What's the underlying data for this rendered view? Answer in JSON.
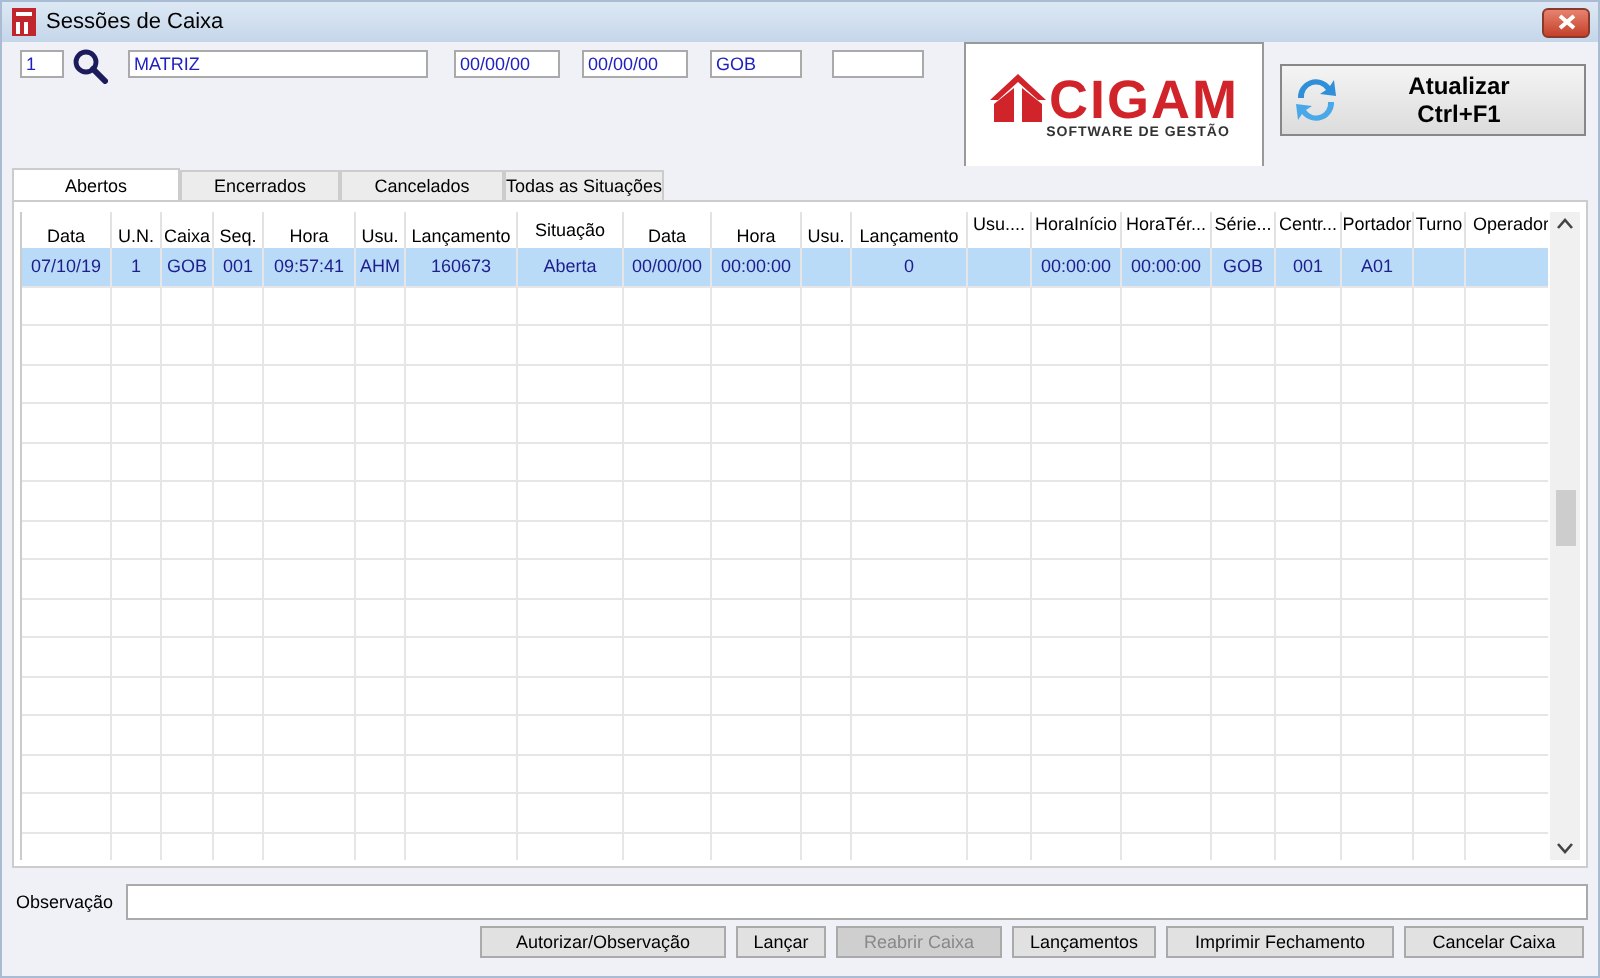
{
  "window": {
    "title": "Sessões de Caixa"
  },
  "filters": [
    {
      "kind": "short",
      "value": "1"
    },
    {
      "kind": "search"
    },
    {
      "kind": "wide",
      "value": "MATRIZ"
    },
    {
      "kind": "date",
      "value": "00/00/00"
    },
    {
      "kind": "date",
      "value": "00/00/00"
    },
    {
      "kind": "code",
      "value": "GOB"
    },
    {
      "kind": "code"
    }
  ],
  "logo": {
    "name": "CIGAM",
    "tagline": "SOFTWARE DE GESTÃO"
  },
  "refresh_button": {
    "label": "Atualizar",
    "shortcut": "Ctrl+F1"
  },
  "tabs": [
    {
      "label": "Abertos",
      "selected": true
    },
    {
      "label": "Encerrados",
      "selected": false
    },
    {
      "label": "Cancelados",
      "selected": false
    },
    {
      "label": "Todas as Situações",
      "selected": false
    }
  ],
  "table": {
    "columns": [
      "Data",
      "U.N.",
      "Caixa",
      "Seq.",
      "Hora",
      "Usu.",
      "Lançamento",
      "Situação",
      "Data",
      "Hora",
      "Usu.",
      "Lançamento",
      "Usu....",
      "HoraInício",
      "HoraTér...",
      "Série...",
      "Centr...",
      "Portador",
      "Turno",
      "Operador"
    ],
    "rows": [
      {
        "selected": true,
        "cells": [
          "07/10/19",
          "1",
          "GOB",
          "001",
          "09:57:41",
          "AHM",
          "160673",
          "Aberta",
          "00/00/00",
          "00:00:00",
          "",
          "0",
          "",
          "00:00:00",
          "00:00:00",
          "GOB",
          "001",
          "A01",
          "",
          ""
        ]
      }
    ]
  },
  "observation": {
    "label": "Observação"
  },
  "buttons": [
    {
      "label": "Autorizar/Observação",
      "disabled": false
    },
    {
      "label": "Lançar",
      "disabled": false
    },
    {
      "label": "Reabrir Caixa",
      "disabled": true
    },
    {
      "label": "Lançamentos",
      "disabled": false
    },
    {
      "label": "Imprimir Fechamento",
      "disabled": false
    },
    {
      "label": "Cancelar Caixa",
      "disabled": false
    }
  ]
}
